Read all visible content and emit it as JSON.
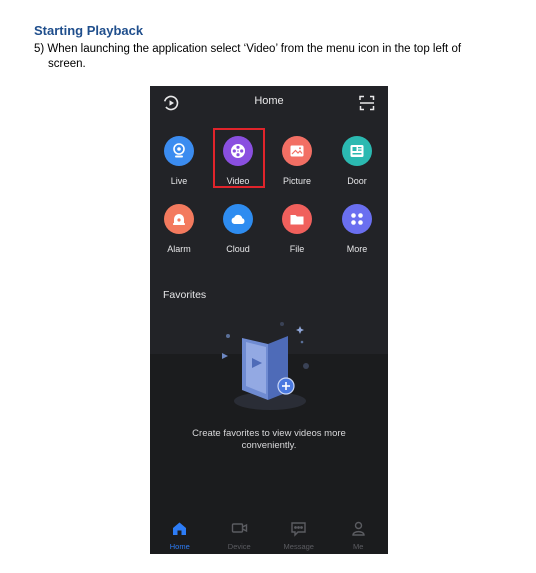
{
  "document": {
    "heading": "Starting Playback",
    "step_text": "5) When launching the application select ‘Video’ from the menu icon in the top left of",
    "step_cont": "screen."
  },
  "app": {
    "title": "Home",
    "tiles": [
      {
        "label": "Live",
        "icon": "camera-icon",
        "color": "#3b8cf0"
      },
      {
        "label": "Video",
        "icon": "film-reel-icon",
        "color": "#8a4fe0"
      },
      {
        "label": "Picture",
        "icon": "picture-icon",
        "color": "#f26f64"
      },
      {
        "label": "Door",
        "icon": "door-phone-icon",
        "color": "#2bb9b1"
      },
      {
        "label": "Alarm",
        "icon": "alarm-icon",
        "color": "#f37a5e"
      },
      {
        "label": "Cloud",
        "icon": "cloud-icon",
        "color": "#2e8cf0"
      },
      {
        "label": "File",
        "icon": "folder-icon",
        "color": "#f0605c"
      },
      {
        "label": "More",
        "icon": "grid-dots-icon",
        "color": "#6a6ff0"
      }
    ],
    "favorites_title": "Favorites",
    "empty_message": "Create favorites to view videos more conveniently.",
    "nav": [
      {
        "label": "Home",
        "active": true
      },
      {
        "label": "Device",
        "active": false
      },
      {
        "label": "Message",
        "active": false
      },
      {
        "label": "Me",
        "active": false
      }
    ],
    "colors": {
      "active": "#2d7cf6",
      "inactive": "#5b5c61",
      "highlight": "#e0242b"
    }
  }
}
